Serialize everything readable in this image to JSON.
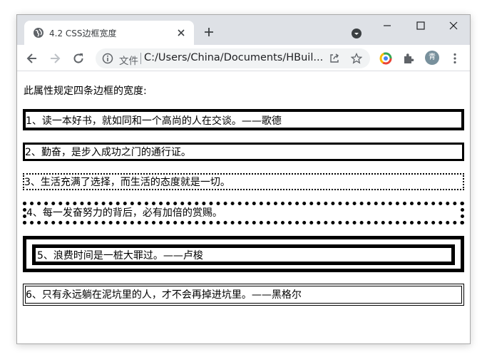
{
  "browser": {
    "tab_title": "4.2 CSS边框宽度",
    "omnibox_label": "文件",
    "url": "C:/Users/China/Documents/HBuil...",
    "profile_initial": "青"
  },
  "page": {
    "intro": "此属性规定四条边框的宽度:",
    "paragraphs": [
      "1、读一本好书，就如同和一个高尚的人在交谈。——歌德",
      "2、勤奋，是步入成功之门的通行证。",
      "3、生活充满了选择，而生活的态度就是一切。",
      "4、每一发奋努力的背后，必有加倍的赏赐。",
      "5、浪费时间是一桩大罪过。——卢梭",
      "6、只有永远躺在泥坑里的人，才不会再掉进坑里。——黑格尔"
    ]
  }
}
